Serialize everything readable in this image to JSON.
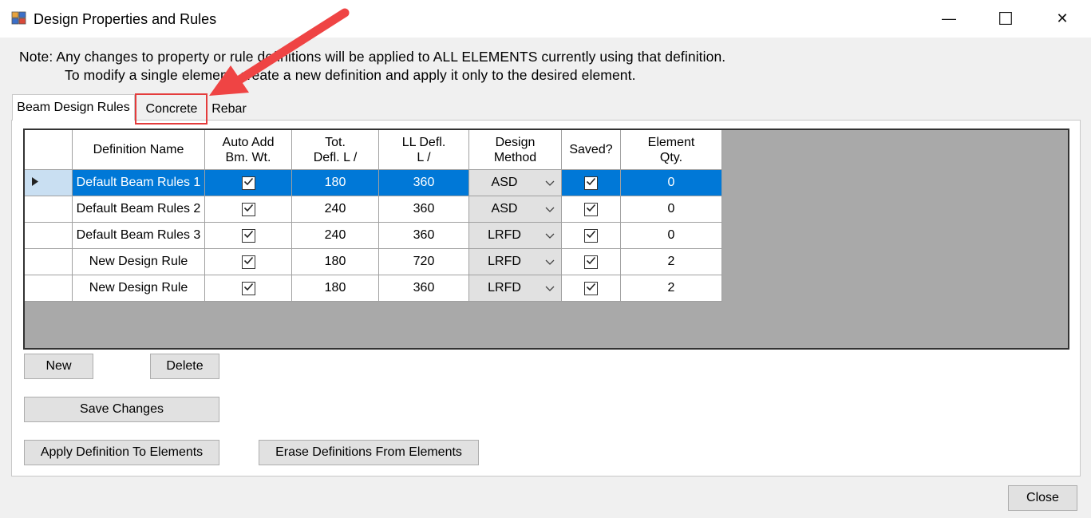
{
  "window": {
    "title": "Design Properties and Rules",
    "minimize": "—",
    "maximize": "☐",
    "close": "✕"
  },
  "note": {
    "line1": "Note:  Any changes to property or rule definitions will be applied to ALL ELEMENTS currently using that definition.",
    "line2": "To modify a single element, create a new definition and apply it only to the desired element."
  },
  "tabs": [
    {
      "label": "Beam Design Rules",
      "active": true
    },
    {
      "label": "Concrete",
      "active": false,
      "highlighted": true
    },
    {
      "label": "Rebar",
      "active": false
    }
  ],
  "grid": {
    "columns": [
      {
        "key": "name",
        "label": "Definition Name"
      },
      {
        "key": "auto_add",
        "label": "Auto Add\nBm. Wt."
      },
      {
        "key": "tot_defl",
        "label": "Tot.\nDefl. L /"
      },
      {
        "key": "ll_defl",
        "label": "LL Defl.\nL /"
      },
      {
        "key": "method",
        "label": "Design\nMethod"
      },
      {
        "key": "saved",
        "label": "Saved?"
      },
      {
        "key": "qty",
        "label": "Element\nQty."
      }
    ],
    "rows": [
      {
        "name": "Default Beam Rules 1",
        "auto_add": true,
        "tot_defl": "180",
        "ll_defl": "360",
        "method": "ASD",
        "saved": true,
        "qty": "0",
        "selected": true
      },
      {
        "name": "Default Beam Rules 2",
        "auto_add": true,
        "tot_defl": "240",
        "ll_defl": "360",
        "method": "ASD",
        "saved": true,
        "qty": "0"
      },
      {
        "name": "Default Beam Rules 3",
        "auto_add": true,
        "tot_defl": "240",
        "ll_defl": "360",
        "method": "LRFD",
        "saved": true,
        "qty": "0"
      },
      {
        "name": "New Design Rule",
        "auto_add": true,
        "tot_defl": "180",
        "ll_defl": "720",
        "method": "LRFD",
        "saved": true,
        "qty": "2"
      },
      {
        "name": "New Design Rule",
        "auto_add": true,
        "tot_defl": "180",
        "ll_defl": "360",
        "method": "LRFD",
        "saved": true,
        "qty": "2"
      }
    ]
  },
  "buttons": {
    "new": "New",
    "delete": "Delete",
    "save_changes": "Save Changes",
    "apply_definition": "Apply Definition To Elements",
    "erase_definitions": "Erase Definitions From Elements",
    "close": "Close"
  },
  "colors": {
    "selection": "#0078d7",
    "highlight": "#e43c3c",
    "grid_background": "#a9a9a9"
  }
}
